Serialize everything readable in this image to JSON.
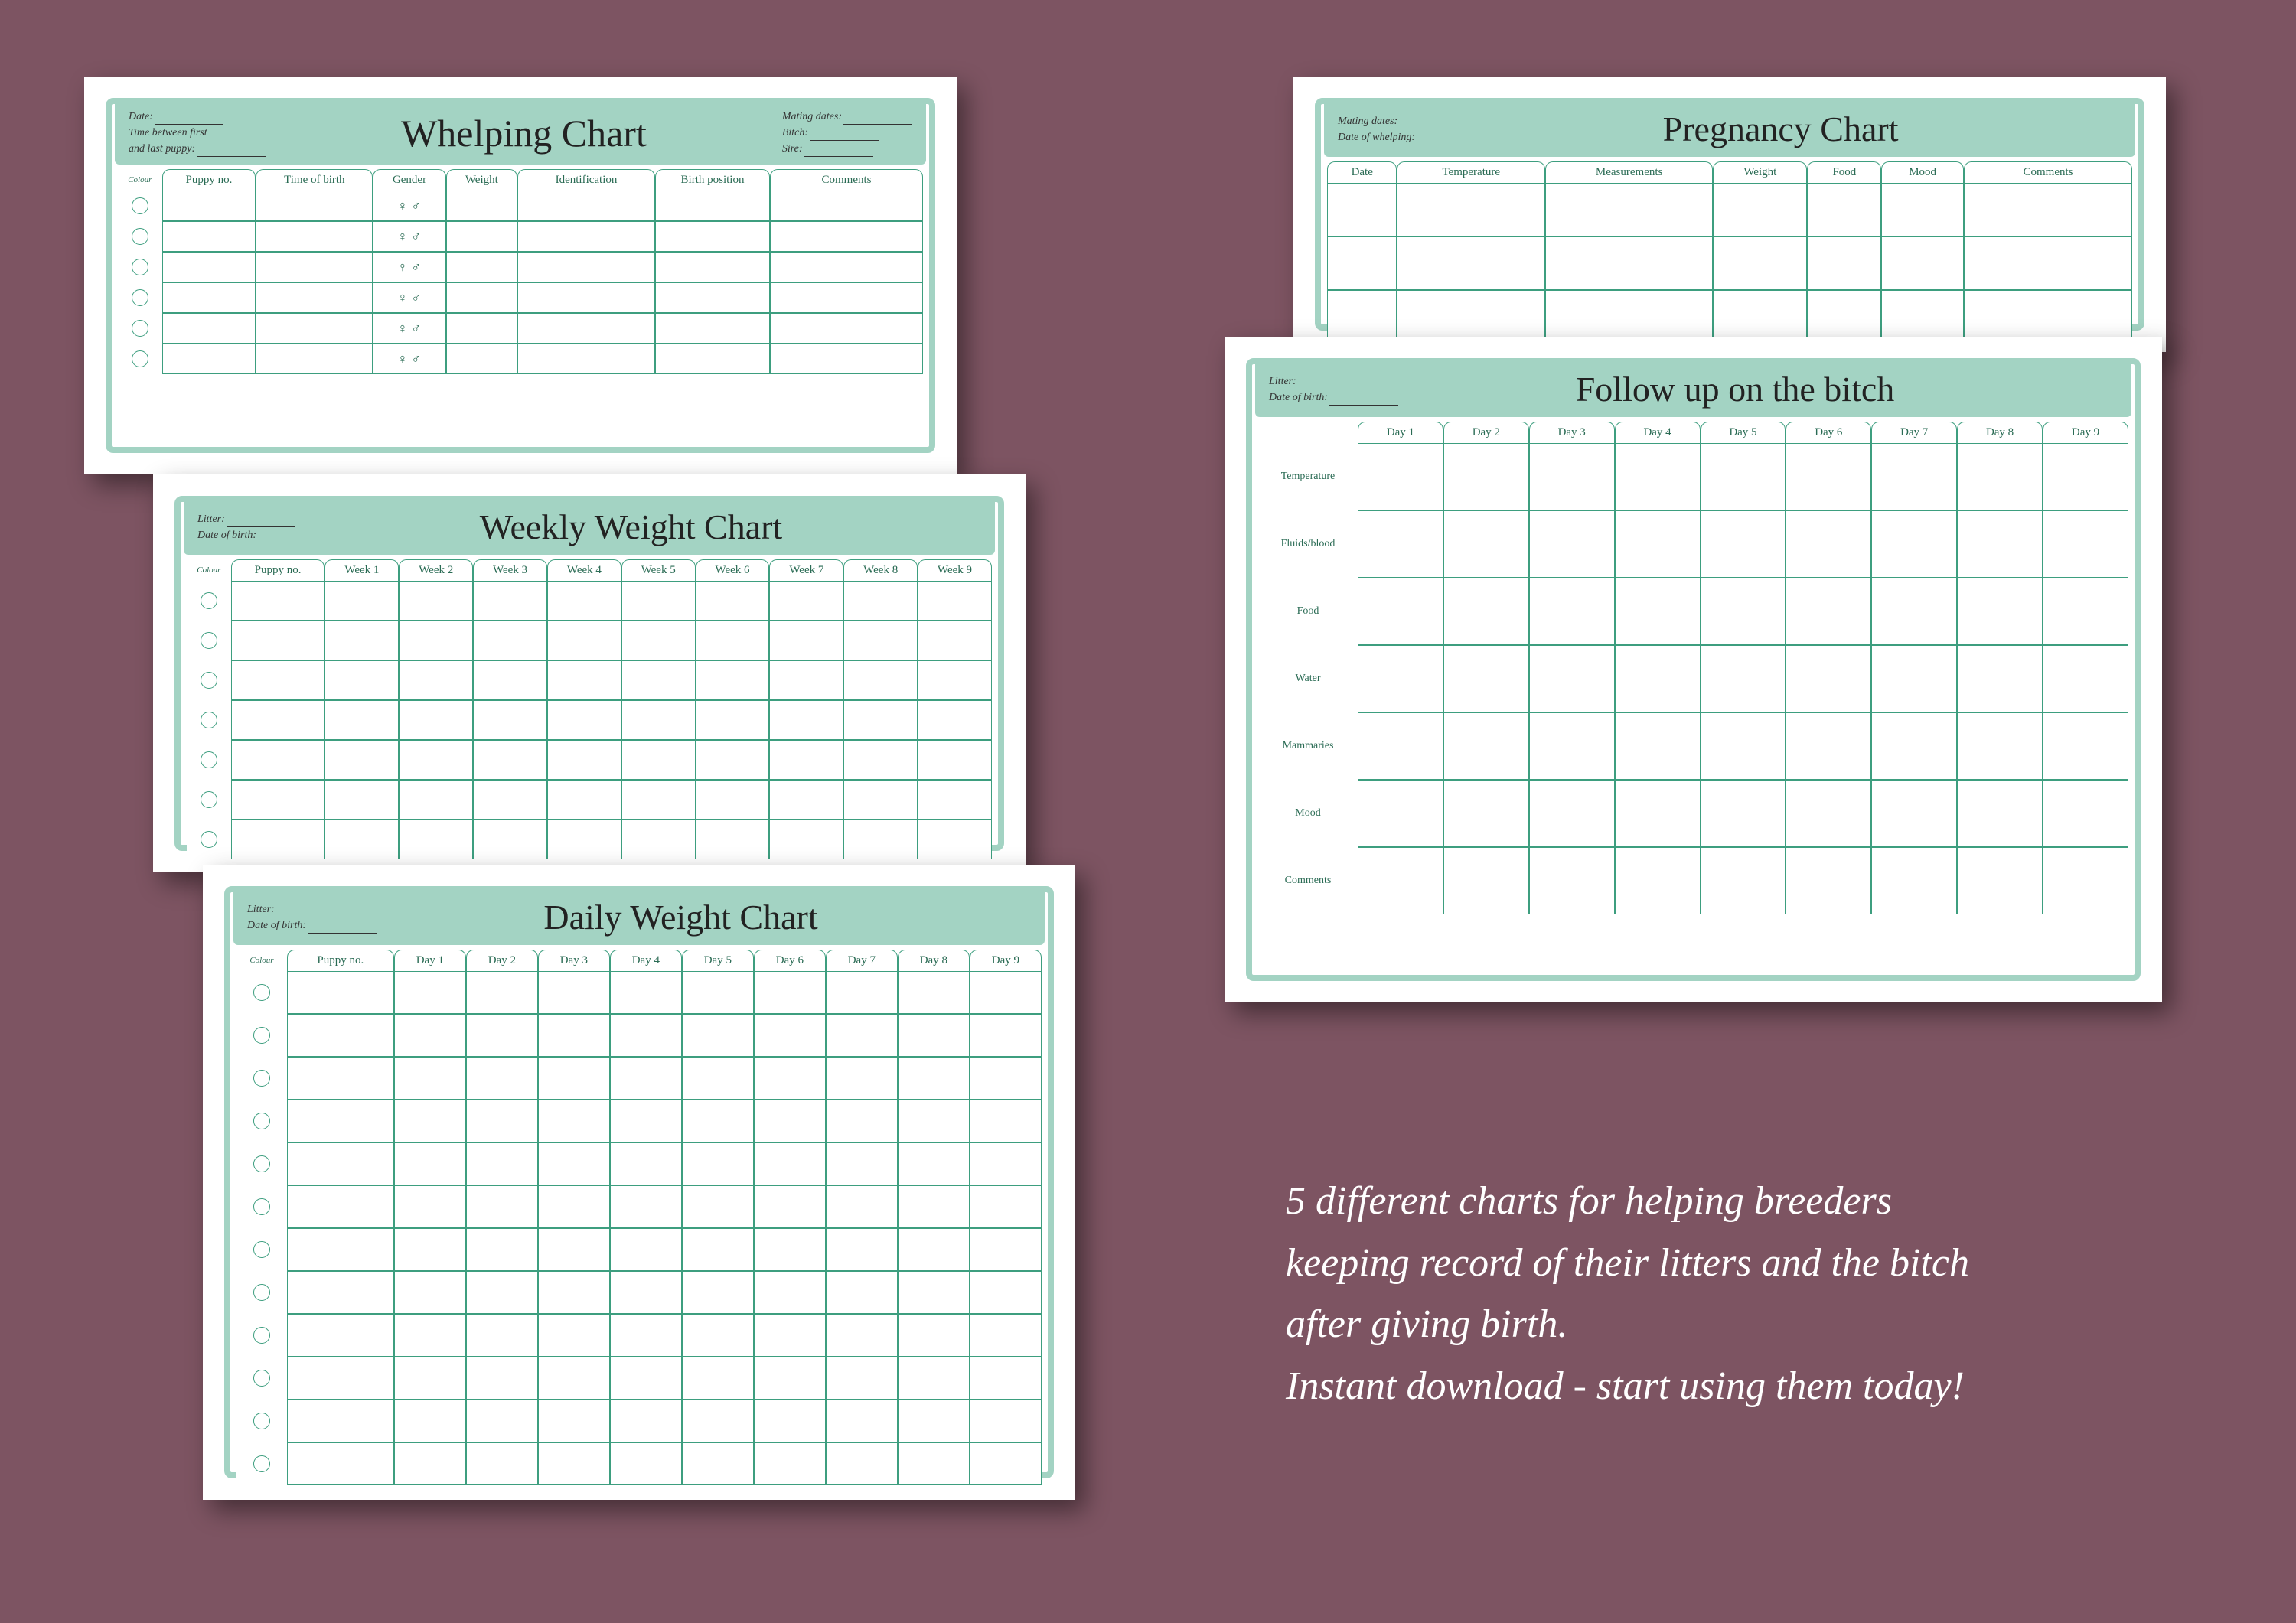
{
  "promo": {
    "line1": "5 different charts for helping breeders",
    "line2": "keeping record of their litters and the bitch",
    "line3": "after giving birth.",
    "line4": "Instant download - start using them today!"
  },
  "colour_label": "Colour",
  "gender_icons": "♀  ♂",
  "whelping": {
    "title": "Whelping Chart",
    "left1": "Date:",
    "left2": "Time between first",
    "left3": "and last puppy:",
    "right1": "Mating dates:",
    "right2": "Bitch:",
    "right3": "Sire:",
    "cols": [
      "Puppy no.",
      "Time of birth",
      "Gender",
      "Weight",
      "Identification",
      "Birth position",
      "Comments"
    ]
  },
  "weekly": {
    "title": "Weekly Weight Chart",
    "left1": "Litter:",
    "left2": "Date of birth:",
    "cols": [
      "Puppy no.",
      "Week 1",
      "Week 2",
      "Week 3",
      "Week 4",
      "Week 5",
      "Week 6",
      "Week 7",
      "Week 8",
      "Week 9"
    ]
  },
  "daily": {
    "title": "Daily Weight Chart",
    "left1": "Litter:",
    "left2": "Date of birth:",
    "cols": [
      "Puppy no.",
      "Day 1",
      "Day 2",
      "Day 3",
      "Day 4",
      "Day 5",
      "Day 6",
      "Day 7",
      "Day 8",
      "Day 9"
    ]
  },
  "pregnancy": {
    "title": "Pregnancy Chart",
    "left1": "Mating dates:",
    "left2": "Date of whelping:",
    "cols": [
      "Date",
      "Temperature",
      "Measurements",
      "Weight",
      "Food",
      "Mood",
      "Comments"
    ]
  },
  "followup": {
    "title": "Follow up on the bitch",
    "left1": "Litter:",
    "left2": "Date of birth:",
    "cols": [
      "Day 1",
      "Day 2",
      "Day 3",
      "Day 4",
      "Day 5",
      "Day 6",
      "Day 7",
      "Day 8",
      "Day 9"
    ],
    "rows": [
      "Temperature",
      "Fluids/blood",
      "Food",
      "Water",
      "Mammaries",
      "Mood",
      "Comments"
    ]
  },
  "chart_data": [
    {
      "type": "table",
      "title": "Whelping Chart",
      "columns": [
        "Puppy no.",
        "Time of birth",
        "Gender",
        "Weight",
        "Identification",
        "Birth position",
        "Comments"
      ],
      "rows_blank": 6,
      "meta_fields": [
        "Date",
        "Time between first and last puppy",
        "Mating dates",
        "Bitch",
        "Sire"
      ]
    },
    {
      "type": "table",
      "title": "Weekly Weight Chart",
      "columns": [
        "Puppy no.",
        "Week 1",
        "Week 2",
        "Week 3",
        "Week 4",
        "Week 5",
        "Week 6",
        "Week 7",
        "Week 8",
        "Week 9"
      ],
      "rows_blank": 7,
      "meta_fields": [
        "Litter",
        "Date of birth"
      ]
    },
    {
      "type": "table",
      "title": "Daily Weight Chart",
      "columns": [
        "Puppy no.",
        "Day 1",
        "Day 2",
        "Day 3",
        "Day 4",
        "Day 5",
        "Day 6",
        "Day 7",
        "Day 8",
        "Day 9"
      ],
      "rows_blank": 12,
      "meta_fields": [
        "Litter",
        "Date of birth"
      ]
    },
    {
      "type": "table",
      "title": "Pregnancy Chart",
      "columns": [
        "Date",
        "Temperature",
        "Measurements",
        "Weight",
        "Food",
        "Mood",
        "Comments"
      ],
      "rows_blank": 3,
      "meta_fields": [
        "Mating dates",
        "Date of whelping"
      ]
    },
    {
      "type": "table",
      "title": "Follow up on the bitch",
      "columns": [
        "Day 1",
        "Day 2",
        "Day 3",
        "Day 4",
        "Day 5",
        "Day 6",
        "Day 7",
        "Day 8",
        "Day 9"
      ],
      "row_labels": [
        "Temperature",
        "Fluids/blood",
        "Food",
        "Water",
        "Mammaries",
        "Mood",
        "Comments"
      ],
      "meta_fields": [
        "Litter",
        "Date of birth"
      ]
    }
  ]
}
